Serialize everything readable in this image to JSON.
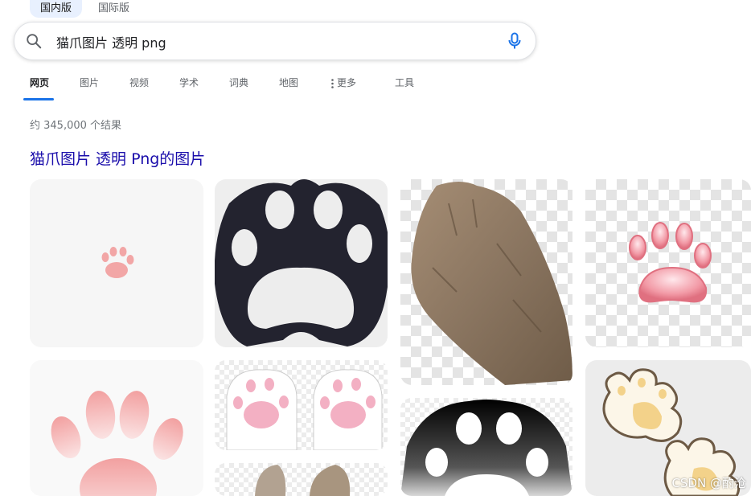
{
  "version": {
    "domestic": "国内版",
    "international": "国际版"
  },
  "search": {
    "query": "猫爪图片 透明 png"
  },
  "tabs": {
    "web": "网页",
    "images": "图片",
    "videos": "视频",
    "academic": "学术",
    "dictionary": "词典",
    "maps": "地图",
    "more": "更多",
    "tools": "工具"
  },
  "result_stats": "约 345,000 个结果",
  "images_heading": "猫爪图片 透明 Png的图片",
  "watermark": "CSDN @酌沧",
  "colors": {
    "accent": "#1a73e8",
    "heading_link": "#1a0dab",
    "paw_dark": "#23232f",
    "paw_pink": "#f2a6a6"
  }
}
